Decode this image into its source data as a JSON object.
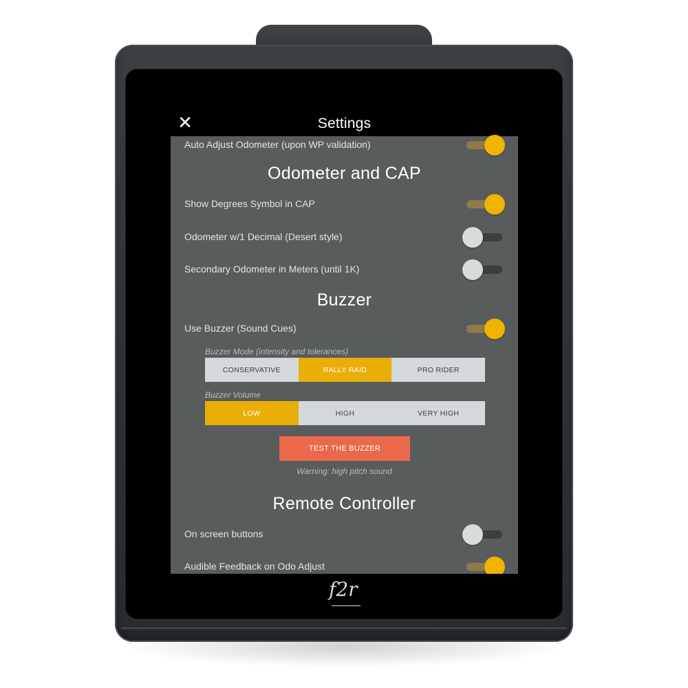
{
  "header": {
    "close_icon": "close-icon",
    "title": "Settings"
  },
  "rows": {
    "auto_adjust": {
      "label": "Auto Adjust Odometer (upon WP validation)",
      "on": true
    },
    "show_degrees": {
      "label": "Show Degrees Symbol in CAP",
      "on": true
    },
    "odometer_decimal": {
      "label": "Odometer w/1 Decimal (Desert style)",
      "on": false
    },
    "secondary_odometer": {
      "label": "Secondary Odometer in Meters (until 1K)",
      "on": false
    },
    "use_buzzer": {
      "label": "Use Buzzer (Sound Cues)",
      "on": true
    },
    "on_screen_buttons": {
      "label": "On screen buttons",
      "on": false
    },
    "audible_feedback": {
      "label": "Audible Feedback on Odo Adjust",
      "on": true
    }
  },
  "sections": {
    "odometer": "Odometer and CAP",
    "buzzer": "Buzzer",
    "remote": "Remote Controller"
  },
  "buzzer_mode": {
    "caption": "Buzzer Mode (intensity and tolerances)",
    "options": [
      "CONSERVATIVE",
      "RALLY RAID",
      "PRO RIDER"
    ],
    "selected": "RALLY RAID"
  },
  "buzzer_volume": {
    "caption": "Buzzer Volume",
    "options": [
      "LOW",
      "HIGH",
      "VERY HIGH"
    ],
    "selected": "LOW"
  },
  "test_button": "TEST THE BUZZER",
  "warning": "Warning: high pitch sound",
  "logo": {
    "main": "f2r"
  },
  "colors": {
    "accent": "#f0b400",
    "selected_segment": "#e9ae07",
    "test_button": "#e9694a",
    "screen_background": "#585c5d"
  }
}
